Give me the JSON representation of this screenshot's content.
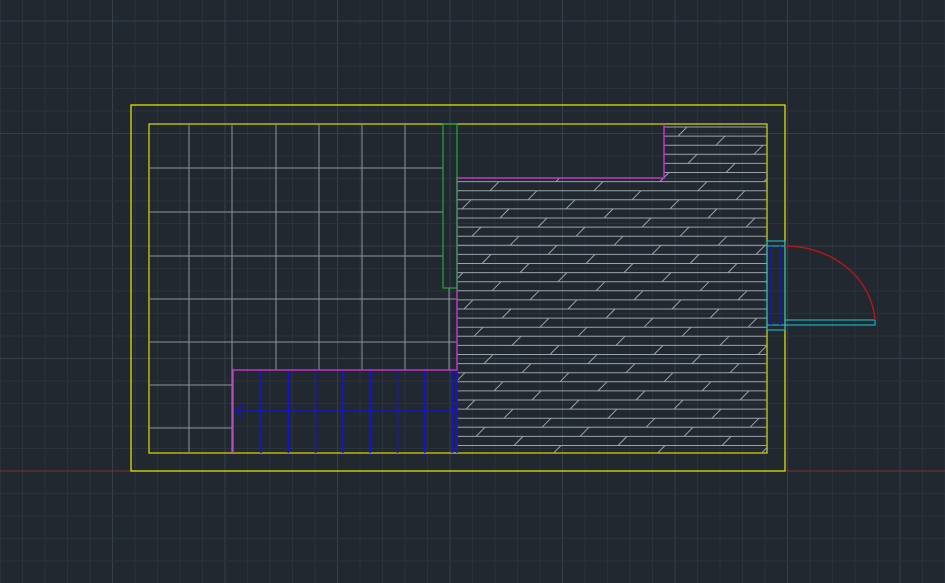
{
  "drawing": {
    "background_color": "#212830",
    "grid_minor_color": "#2a323b",
    "grid_major_color": "#35404b",
    "axis_color": "#7a2f31",
    "outer_wall_color": "#f1f100",
    "inner_wall_color": "#dcdc00",
    "partition_color": "#c036c8",
    "closet_color": "#22a938",
    "tile_color": "#8d949d",
    "floor_hatch_color": "#9aa2ab",
    "stair_color": "#1414d8",
    "door_frame_color": "#1fc7d3",
    "door_swing_color": "#b01818"
  }
}
